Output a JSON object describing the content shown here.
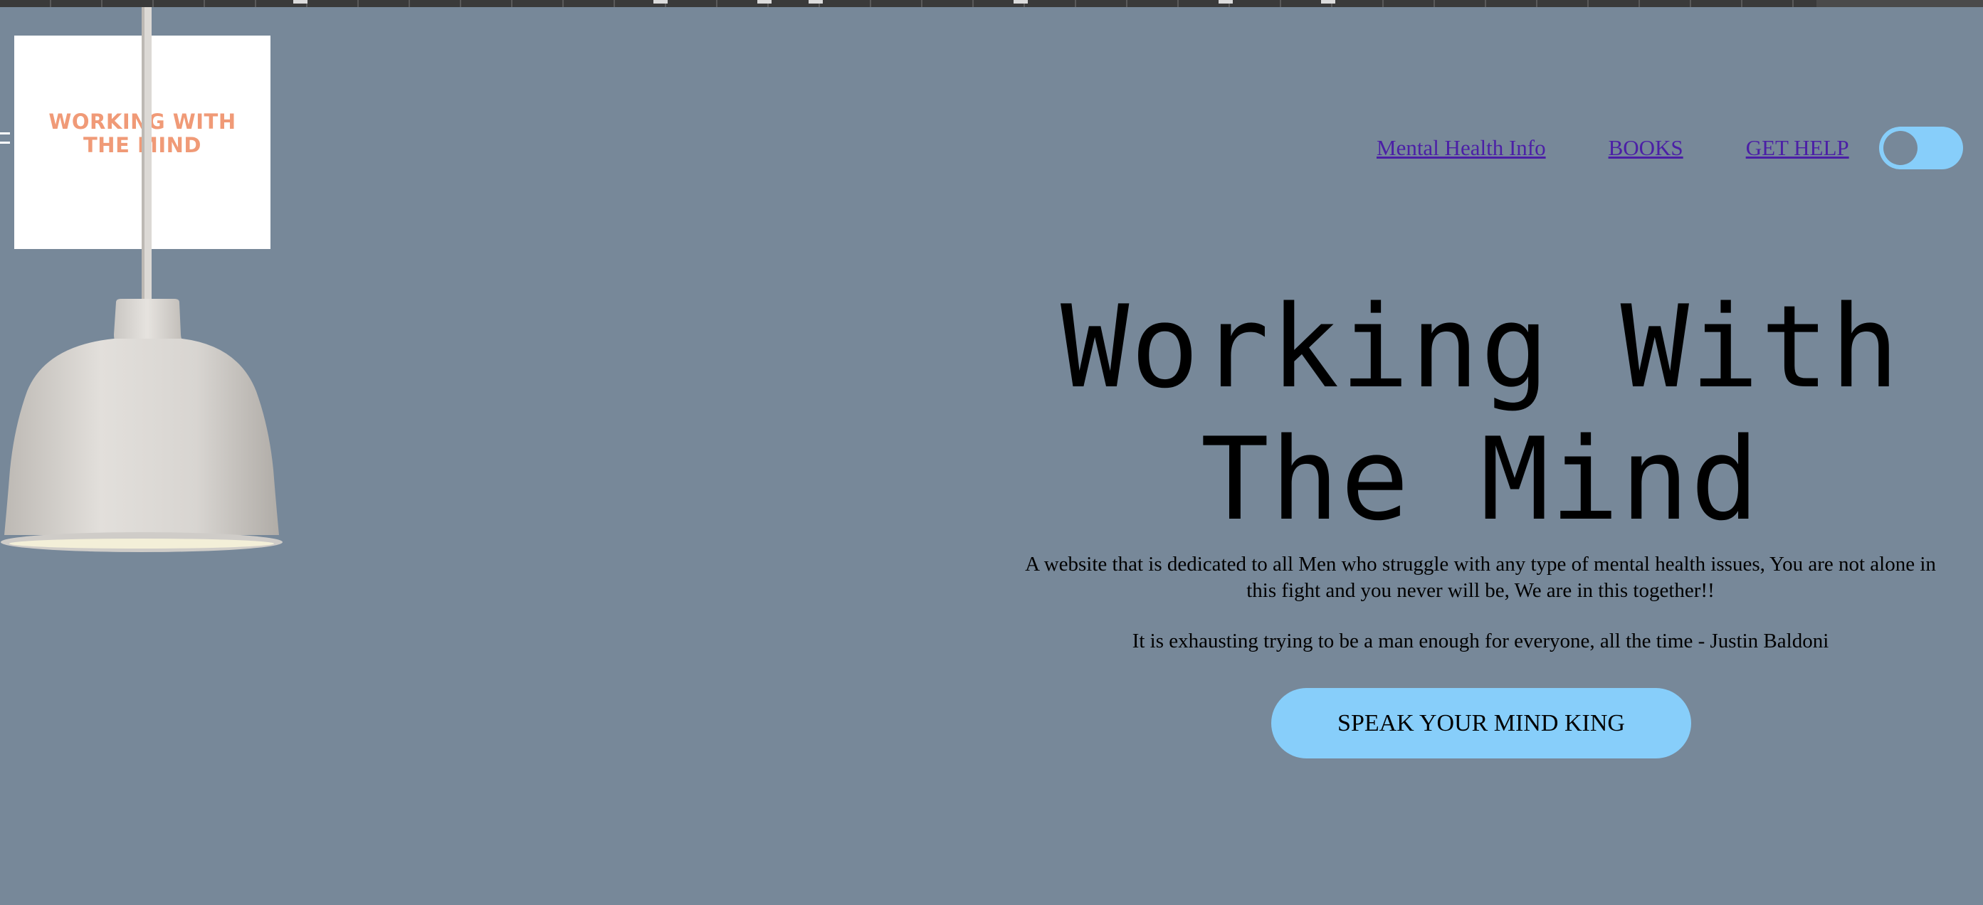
{
  "logo": {
    "line1": "WORKING WITH",
    "line2": "THE MIND"
  },
  "nav": {
    "items": [
      {
        "label": "Mental Health Info"
      },
      {
        "label": "BOOKS"
      },
      {
        "label": "GET HELP"
      }
    ],
    "toggle": {
      "state": "off"
    }
  },
  "hero": {
    "title_line1": "Working With",
    "title_line2": "The Mind",
    "description_line1": "A website that is dedicated to all Men who struggle with any type of mental health issues, You are not alone in",
    "description_line2": "this fight and you never will be, We are in this together!!",
    "quote": "It is exhausting trying to be a man enough for everyone, all the time - Justin Baldoni",
    "cta_label": "SPEAK YOUR MIND KING"
  },
  "colors": {
    "background": "#778899",
    "accent": "#87cefa",
    "link": "#4b1fa6",
    "logo_text": "#f09a77"
  },
  "icons": [
    "pendant-lamp-icon",
    "toggle-switch-icon"
  ]
}
